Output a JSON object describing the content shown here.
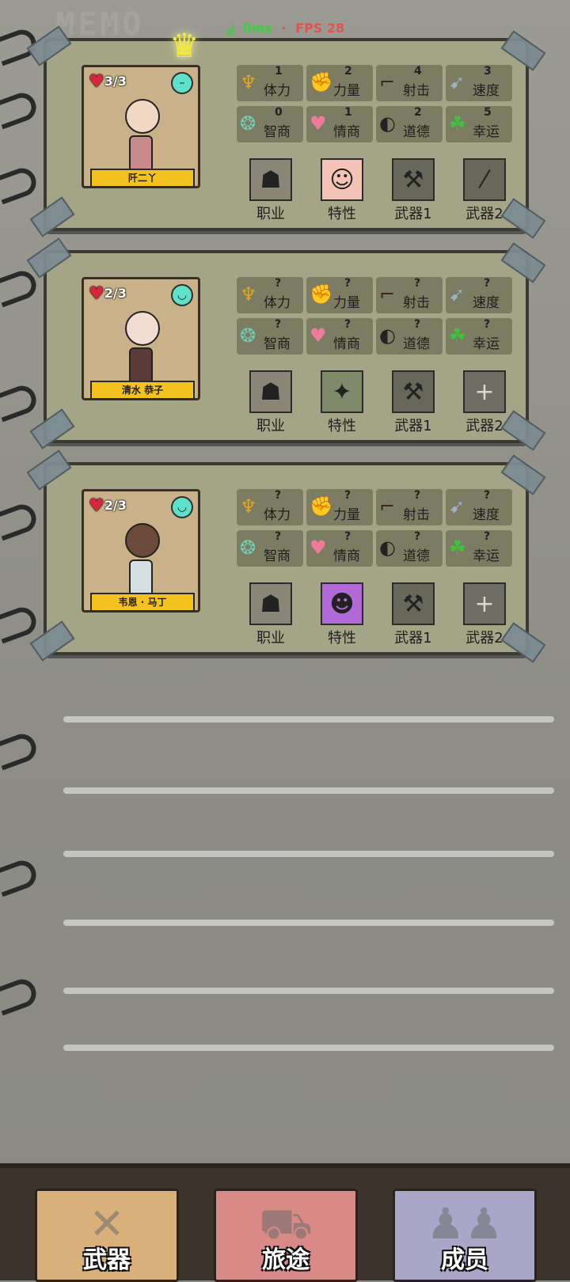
{
  "status": {
    "ping": "0ms",
    "separator": "·",
    "fps": "FPS 28"
  },
  "header": {
    "memo": "MEMO"
  },
  "stat_labels": [
    "体力",
    "力量",
    "射击",
    "速度",
    "智商",
    "情商",
    "道德",
    "幸运"
  ],
  "slot_labels": [
    "职业",
    "特性",
    "武器1",
    "武器2"
  ],
  "characters": [
    {
      "name": "阡二丫",
      "hp": "3/3",
      "leader": true,
      "stats": [
        "1",
        "2",
        "4",
        "3",
        "0",
        "1",
        "2",
        "5"
      ],
      "slots": [
        "occupation-avatar",
        "trait-baby",
        "axe",
        "rifle"
      ]
    },
    {
      "name": "清水 恭子",
      "hp": "2/3",
      "leader": false,
      "stats": [
        "?",
        "?",
        "?",
        "?",
        "?",
        "?",
        "?",
        "?"
      ],
      "slots": [
        "occupation-avatar",
        "trait-image",
        "axe",
        "empty"
      ]
    },
    {
      "name": "韦恩 · 马丁",
      "hp": "2/3",
      "leader": false,
      "stats": [
        "?",
        "?",
        "?",
        "?",
        "?",
        "?",
        "?",
        "?"
      ],
      "slots": [
        "occupation-avatar",
        "trait-purple-monster",
        "axe",
        "empty"
      ]
    }
  ],
  "bottom_nav": {
    "weapons": "武器",
    "journey": "旅途",
    "members": "成员"
  },
  "colors": {
    "card_bg": "#a4a586",
    "nameplate": "#f3c21e",
    "heart": "#d7263d",
    "mood": "#5fe0c8"
  }
}
